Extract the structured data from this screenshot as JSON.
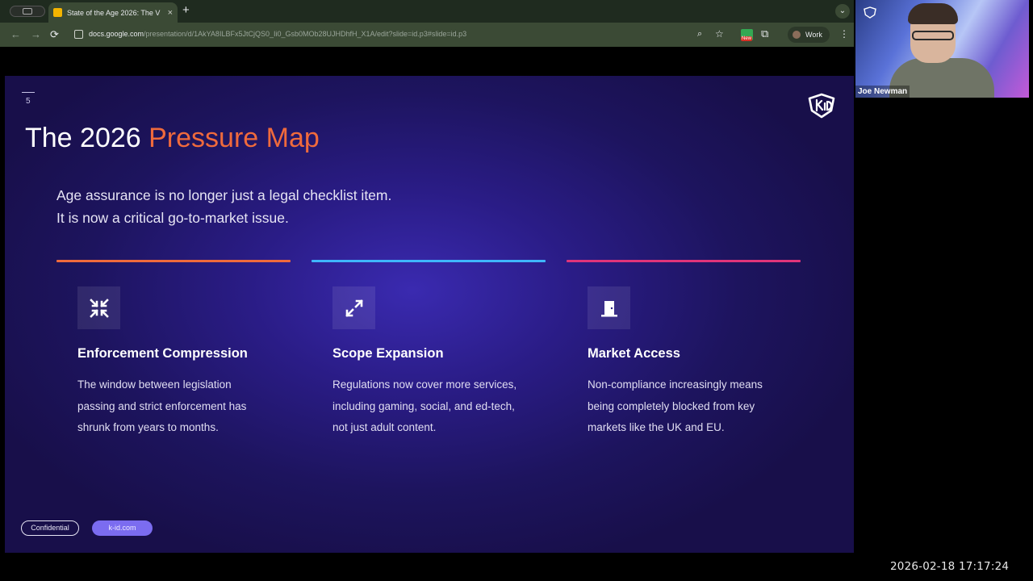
{
  "browser": {
    "tab": {
      "title": "State of the Age 2026: The V",
      "close": "×"
    },
    "new_tab": "+",
    "tab_menu": "⌄",
    "nav": {
      "back": "←",
      "forward": "→",
      "reload": "⟳"
    },
    "url": {
      "host": "docs.google.com",
      "path": "/presentation/d/1AkYA8ILBFx5JtCjQS0_Ii0_Gsb0MOb28UJHDhfH_X1A/edit?slide=id.p3#slide=id.p3"
    },
    "extension_badge": "New",
    "profile_label": "Work",
    "menu": "⋮"
  },
  "slide": {
    "number": "5",
    "title_prefix": "The 2026 ",
    "title_accent": "Pressure Map",
    "lead_line1": "Age assurance is no longer just a legal checklist item.",
    "lead_line2": "It is now a critical go-to-market issue.",
    "columns": [
      {
        "icon": "compress-icon",
        "accent": "#ef6a3c",
        "title": "Enforcement Compression",
        "body": "The window between legislation passing and strict enforcement has shrunk from years to months."
      },
      {
        "icon": "expand-icon",
        "accent": "#3fb6ff",
        "title": "Scope Expansion",
        "body": "Regulations now cover more services, including gaming, social, and ed-tech, not just adult content."
      },
      {
        "icon": "door-icon",
        "accent": "#e0347a",
        "title": "Market Access",
        "body": "Non-compliance increasingly means being completely blocked from key markets like the UK and EU."
      }
    ],
    "footer": {
      "confidential": "Confidential",
      "site": "k-id.com"
    }
  },
  "video": {
    "participant_name": "Joe Newman"
  },
  "timestamp": "2026-02-18  17:17:24"
}
